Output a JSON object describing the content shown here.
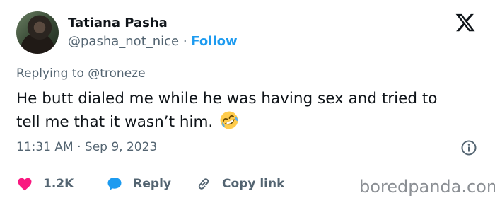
{
  "author": {
    "name": "Tatiana Pasha",
    "handle": "@pasha_not_nice",
    "separator": "·",
    "follow_label": "Follow"
  },
  "reply_context": {
    "prefix": "Replying to",
    "mention": "@troneze"
  },
  "tweet": {
    "text": "He butt dialed me while he was having sex and tried to tell me that it wasn’t him.",
    "emoji": "rolling-on-the-floor-laughing"
  },
  "meta": {
    "time": "11:31 AM",
    "separator": "·",
    "date": "Sep 9, 2023"
  },
  "actions": {
    "like_count": "1.2K",
    "reply_label": "Reply",
    "copy_label": "Copy link"
  },
  "watermark": "boredpanda.com",
  "colors": {
    "accent": "#1d9bf0",
    "like": "#f91880",
    "reply": "#1d9bf0",
    "secondary_text": "#536471",
    "primary_text": "#0f1419"
  },
  "icons": {
    "brand": "x-logo-icon",
    "info": "info-icon",
    "like": "heart-icon",
    "reply": "speech-bubble-icon",
    "copy": "link-icon"
  }
}
